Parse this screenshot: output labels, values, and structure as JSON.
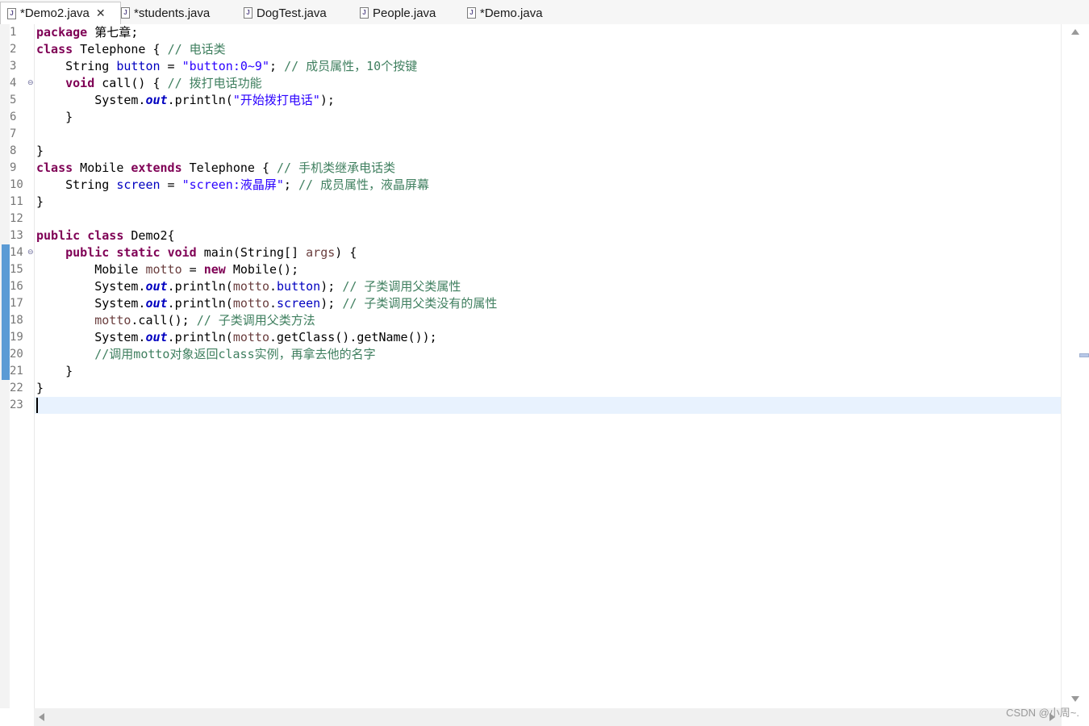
{
  "tabs": [
    {
      "label": "*Demo2.java",
      "active": true,
      "closable": true
    },
    {
      "label": "*students.java",
      "active": false
    },
    {
      "label": "DogTest.java",
      "active": false
    },
    {
      "label": "People.java",
      "active": false
    },
    {
      "label": "*Demo.java",
      "active": false
    }
  ],
  "line_numbers": [
    "1",
    "2",
    "3",
    "4",
    "5",
    "6",
    "7",
    "8",
    "9",
    "10",
    "11",
    "12",
    "13",
    "14",
    "15",
    "16",
    "17",
    "18",
    "19",
    "20",
    "21",
    "22",
    "23"
  ],
  "code": {
    "l1": {
      "kw": "package",
      "rest": " 第七章;"
    },
    "l2": {
      "kw": "class",
      "name": " Telephone { ",
      "comment": "// 电话类"
    },
    "l3": {
      "indent": "    String ",
      "field": "button",
      "eq": " = ",
      "str": "\"button:0~9\"",
      "semi": "; ",
      "comment": "// 成员属性，10个按键"
    },
    "l4": {
      "indent": "    ",
      "kw": "void",
      "rest": " call() { ",
      "comment": "// 拨打电话功能"
    },
    "l5": {
      "indent": "        System.",
      "sfield": "out",
      "rest": ".println(",
      "str": "\"开始拨打电话\"",
      "end": ");"
    },
    "l6": {
      "text": "    }"
    },
    "l7": {
      "text": ""
    },
    "l8": {
      "text": "}"
    },
    "l9": {
      "kw": "class",
      "name": " Mobile ",
      "kw2": "extends",
      "rest": " Telephone { ",
      "comment": "// 手机类继承电话类"
    },
    "l10": {
      "indent": "    String ",
      "field": "screen",
      "eq": " = ",
      "str": "\"screen:液晶屏\"",
      "semi": "; ",
      "comment": "// 成员属性，液晶屏幕"
    },
    "l11": {
      "text": "}"
    },
    "l12": {
      "text": ""
    },
    "l13": {
      "kw": "public",
      "sp": " ",
      "kw2": "class",
      "rest": " Demo2{"
    },
    "l14": {
      "indent": "    ",
      "kw": "public",
      "sp1": " ",
      "kw2": "static",
      "sp2": " ",
      "kw3": "void",
      "rest": " main(String[] ",
      "var": "args",
      "end": ") {"
    },
    "l15": {
      "indent": "        Mobile ",
      "var": "motto",
      "eq": " = ",
      "kw": "new",
      "rest": " Mobile();"
    },
    "l16": {
      "indent": "        System.",
      "sfield": "out",
      "p": ".println(",
      "var": "motto",
      "dot": ".",
      "field": "button",
      "end": "); ",
      "comment": "// 子类调用父类属性"
    },
    "l17": {
      "indent": "        System.",
      "sfield": "out",
      "p": ".println(",
      "var": "motto",
      "dot": ".",
      "field": "screen",
      "end": "); ",
      "comment": "// 子类调用父类没有的属性"
    },
    "l18": {
      "indent": "        ",
      "var": "motto",
      "rest": ".call(); ",
      "comment": "// 子类调用父类方法"
    },
    "l19": {
      "indent": "        System.",
      "sfield": "out",
      "rest": ".println(",
      "var": "motto",
      "end": ".getClass().getName());"
    },
    "l20": {
      "indent": "        ",
      "comment": "//调用motto对象返回class实例，再拿去他的名字"
    },
    "l21": {
      "text": "    }"
    },
    "l22": {
      "text": "}"
    },
    "l23": {
      "text": ""
    }
  },
  "watermark": "CSDN @小周~."
}
